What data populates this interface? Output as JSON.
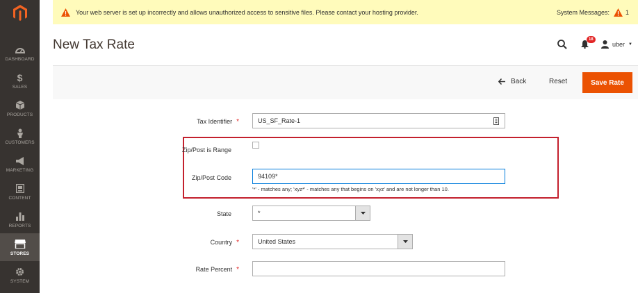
{
  "sidebar": {
    "items": [
      {
        "label": "DASHBOARD",
        "icon": "dashboard-icon"
      },
      {
        "label": "SALES",
        "icon": "dollar-icon"
      },
      {
        "label": "PRODUCTS",
        "icon": "cube-icon"
      },
      {
        "label": "CUSTOMERS",
        "icon": "person-icon"
      },
      {
        "label": "MARKETING",
        "icon": "megaphone-icon"
      },
      {
        "label": "CONTENT",
        "icon": "content-icon"
      },
      {
        "label": "REPORTS",
        "icon": "bar-chart-icon"
      },
      {
        "label": "STORES",
        "icon": "store-icon",
        "active": true
      },
      {
        "label": "SYSTEM",
        "icon": "gear-icon"
      }
    ]
  },
  "notice": {
    "message": "Your web server is set up incorrectly and allows unauthorized access to sensitive files. Please contact your hosting provider.",
    "system_messages_label": "System Messages:",
    "system_messages_count": "1"
  },
  "header": {
    "title": "New Tax Rate",
    "notifications_count": "18",
    "user_name": "uber"
  },
  "actions": {
    "back_label": "Back",
    "reset_label": "Reset",
    "save_label": "Save Rate"
  },
  "form": {
    "tax_identifier_label": "Tax Identifier",
    "tax_identifier_value": "US_SF_Rate-1",
    "zip_range_label": "Zip/Post is Range",
    "zip_code_label": "Zip/Post Code",
    "zip_code_value": "94109*",
    "zip_code_note": "'*' - matches any; 'xyz*' - matches any that begins on 'xyz' and are not longer than 10.",
    "state_label": "State",
    "state_value": "*",
    "country_label": "Country",
    "country_value": "United States",
    "rate_percent_label": "Rate Percent",
    "rate_percent_value": "",
    "required_mark": "*"
  },
  "colors": {
    "sidebar_bg": "#373330",
    "accent": "#eb5202",
    "notice_bg": "#fffbbb",
    "highlight_border": "#c3202d"
  }
}
